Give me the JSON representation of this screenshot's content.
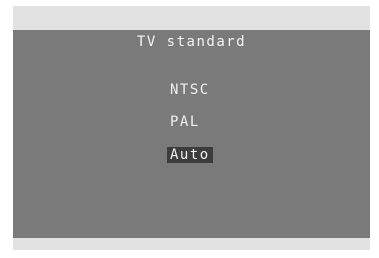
{
  "menu": {
    "title": "TV standard",
    "options": [
      {
        "label": "NTSC",
        "selected": false
      },
      {
        "label": "PAL",
        "selected": false
      },
      {
        "label": "Auto",
        "selected": true
      }
    ]
  },
  "colors": {
    "panel_background": "#7a7a7a",
    "screen_background": "#e2e2e2",
    "text": "#f0f0f0",
    "selection_highlight": "#3c3c3c"
  }
}
